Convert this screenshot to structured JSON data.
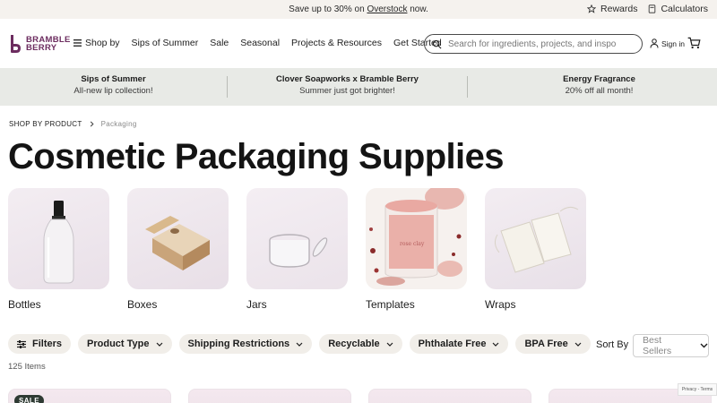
{
  "promo": {
    "text_before": "Save up to 30% on ",
    "link": "Overstock",
    "text_after": " now.",
    "rewards": "Rewards",
    "calculators": "Calculators"
  },
  "header": {
    "logo_line1": "BRAMBLE",
    "logo_line2": "BERRY",
    "nav": [
      "Shop by",
      "Sips of Summer",
      "Sale",
      "Seasonal",
      "Projects & Resources",
      "Get Started"
    ],
    "search_placeholder": "Search for ingredients, projects, and inspo",
    "signin": "Sign in"
  },
  "banners": [
    {
      "title": "Sips of Summer",
      "subtitle": "All-new lip collection!"
    },
    {
      "title": "Clover Soapworks x Bramble Berry",
      "subtitle": "Summer just got brighter!"
    },
    {
      "title": "Energy Fragrance",
      "subtitle": "20% off all month!"
    }
  ],
  "breadcrumb": {
    "parent": "SHOP BY PRODUCT",
    "current": "Packaging"
  },
  "page_title": "Cosmetic Packaging Supplies",
  "categories": [
    {
      "label": "Bottles",
      "icon": "bottle-image"
    },
    {
      "label": "Boxes",
      "icon": "box-image"
    },
    {
      "label": "Jars",
      "icon": "jar-image"
    },
    {
      "label": "Templates",
      "icon": "template-image"
    },
    {
      "label": "Wraps",
      "icon": "wrap-image"
    }
  ],
  "filters": {
    "filters_label": "Filters",
    "pills": [
      "Product Type",
      "Shipping Restrictions",
      "Recyclable",
      "Phthalate Free",
      "BPA Free"
    ]
  },
  "sort": {
    "label": "Sort By",
    "value": "Best Sellers"
  },
  "item_count": "125 Items",
  "cards": [
    {
      "badge": "SALE"
    },
    {
      "badge": ""
    },
    {
      "badge": ""
    },
    {
      "badge": ""
    }
  ],
  "recaptcha": "Privacy - Terms",
  "colors": {
    "brand": "#6c2c5f",
    "promo_bg": "#f5f2ee",
    "banner_bg": "#e8eae6",
    "pill_bg": "#f1eee9"
  }
}
